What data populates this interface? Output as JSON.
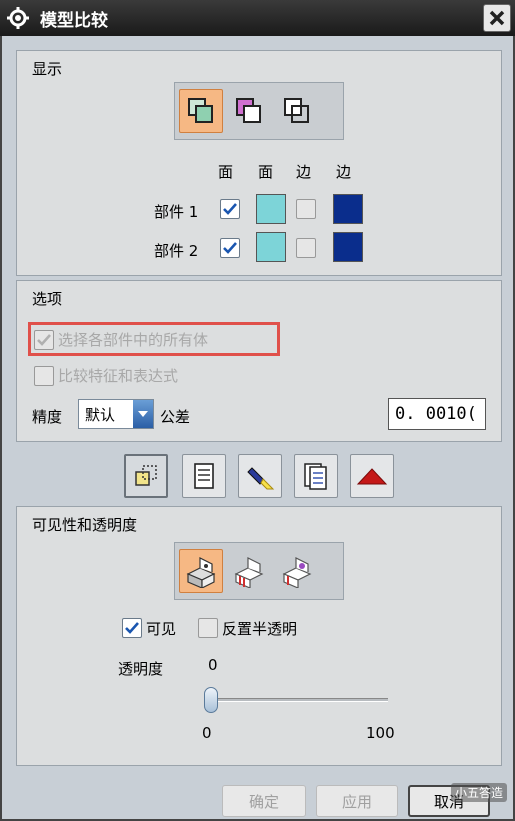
{
  "window": {
    "title": "模型比较",
    "icons": {
      "settings": "gear-icon",
      "close": "close-icon"
    }
  },
  "display": {
    "section_label": "显示",
    "mode_icons": [
      "overlap-active-icon",
      "overlap-magenta-icon",
      "overlap-outline-icon"
    ],
    "col_headers": [
      "面",
      "面",
      "边",
      "边"
    ],
    "rows": [
      {
        "label": "部件 1",
        "checked": true,
        "face_color": "#7dd4d8",
        "edge_checked": false,
        "edge_color": "#0a2d8c"
      },
      {
        "label": "部件 2",
        "checked": true,
        "face_color": "#7dd4d8",
        "edge_checked": false,
        "edge_color": "#0a2d8c"
      }
    ]
  },
  "options": {
    "section_label": "选项",
    "select_all_bodies": "选择各部件中的所有体",
    "compare_features": "比较特征和表达式",
    "precision_label": "精度",
    "precision_value": "默认",
    "tolerance_label": "公差",
    "tolerance_value": "0. 0010("
  },
  "toolbar": {
    "icons": [
      "compare-icon",
      "list-icon",
      "flashlight-icon",
      "report-icon",
      "collapse-arrow-icon"
    ]
  },
  "visibility": {
    "section_label": "可见性和透明度",
    "mode_icons": [
      "part-view-active-icon",
      "part-view-red-icon",
      "part-view-purple-icon"
    ],
    "visible_label": "可见",
    "visible_checked": true,
    "reverse_label": "反置半透明",
    "reverse_checked": false,
    "transparency_label": "透明度",
    "transparency_value": "0",
    "slider_min": "0",
    "slider_max": "100"
  },
  "buttons": {
    "ok": "确定",
    "apply": "应用",
    "cancel": "取消"
  },
  "watermark": "小五答造",
  "colors": {
    "accent_orange": "#f6b884",
    "face_cyan": "#7dd4d8",
    "edge_blue": "#0a2d8c",
    "highlight_red": "#e0504a"
  }
}
